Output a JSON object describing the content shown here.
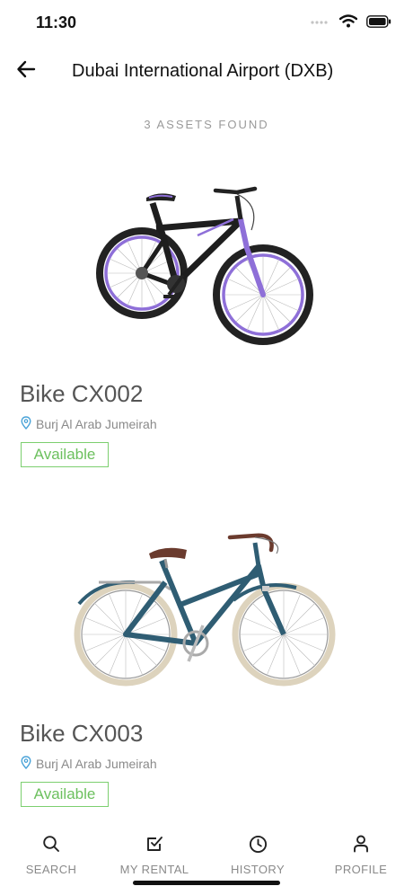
{
  "status_bar": {
    "time": "11:30"
  },
  "header": {
    "title": "Dubai International Airport (DXB)",
    "back_icon": "arrow-left-icon"
  },
  "results": {
    "count_label": "3 ASSETS FOUND"
  },
  "assets": [
    {
      "name": "Bike CX002",
      "location": "Burj Al Arab Jumeirah",
      "status": "Available"
    },
    {
      "name": "Bike CX003",
      "location": "Burj Al Arab Jumeirah",
      "status": "Available"
    }
  ],
  "nav": {
    "items": [
      {
        "label": "SEARCH",
        "icon": "search-icon"
      },
      {
        "label": "MY RENTAL",
        "icon": "check-square-icon"
      },
      {
        "label": "HISTORY",
        "icon": "clock-icon"
      },
      {
        "label": "PROFILE",
        "icon": "user-icon"
      }
    ]
  },
  "colors": {
    "available": "#6cc05e",
    "location_pin": "#4aa3d8",
    "bike1_accent": "#8e6fd8",
    "bike2_frame": "#2f5d73"
  }
}
